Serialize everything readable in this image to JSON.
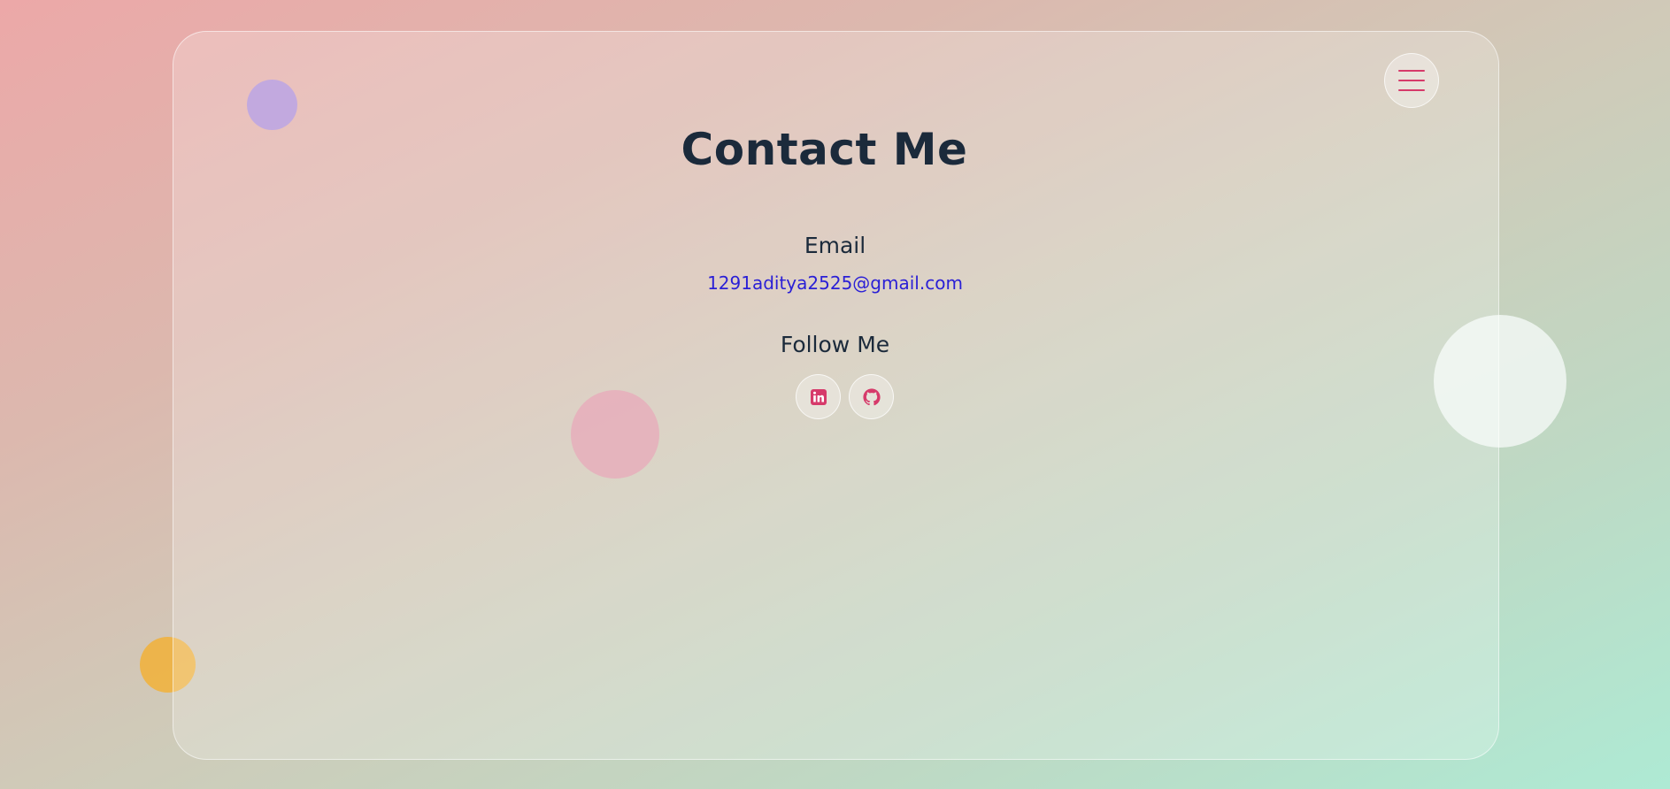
{
  "header": {
    "title": "Contact Me",
    "menu_icon": "hamburger-menu-icon"
  },
  "email_section": {
    "heading": "Email",
    "address": "1291aditya2525@gmail.com",
    "link_color": "#2a1fd6"
  },
  "social_section": {
    "heading": "Follow Me",
    "links": [
      {
        "icon": "linkedin-icon"
      },
      {
        "icon": "github-icon"
      }
    ]
  },
  "colors": {
    "accent": "#d63a6a",
    "text": "#1b2a3b",
    "background_start": "#eca8a8",
    "background_end": "#aeead4"
  }
}
